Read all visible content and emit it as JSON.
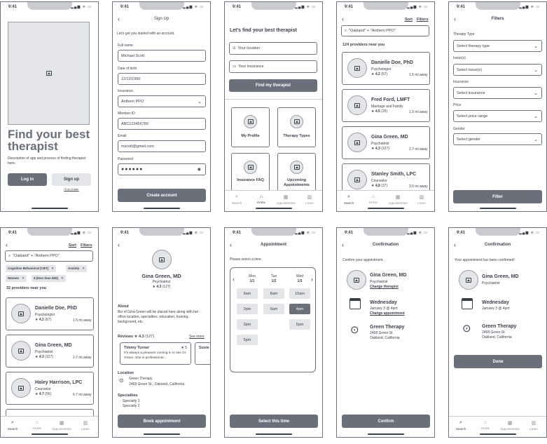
{
  "status": {
    "time": "9:41",
    "icons": "▂▄▆ ≋ ▭"
  },
  "screen1": {
    "title": "Find your best therapist",
    "desc": "Description of app and process of finding therapist here.",
    "login": "Log in",
    "signup": "Sign up",
    "later": "I'll do it later"
  },
  "screen2": {
    "title": "Sign Up",
    "intro": "Let's get you started with an account.",
    "fields": [
      {
        "label": "Full name",
        "value": "Michael Scott"
      },
      {
        "label": "Date of birth",
        "value": "12/12/1990"
      },
      {
        "label": "Insurance",
        "value": "Anthem PPO"
      },
      {
        "label": "Member ID",
        "value": "ABC123456789"
      },
      {
        "label": "Email",
        "value": "mscott@gmail.com"
      },
      {
        "label": "Password",
        "value": "●●●●●●"
      }
    ],
    "create": "Create account"
  },
  "screen3": {
    "title": "Let's find your best therapist",
    "location_ph": "Your location",
    "insurance_ph": "Your insurance",
    "find": "Find my therapist",
    "tiles": [
      "My Profile",
      "Therapy Types",
      "Insurance FAQ",
      "Upcoming Appointments"
    ]
  },
  "tabs": [
    "Search",
    "Home",
    "Appointments",
    "Learn"
  ],
  "tab_icons": {
    "search": "⌕",
    "home": "⌂",
    "appointments": "▦",
    "learn": "▥"
  },
  "screen4": {
    "sort": "Sort",
    "filters": "Filters",
    "query": "\"Oakland\" + \"Anthem PPO\"",
    "count": "124 providers near you",
    "cards": [
      {
        "name": "Danielle Doe, PhD",
        "role": "Psychologist",
        "rating": "4.2",
        "reviews": "(67)",
        "dist": "1.5 mi away"
      },
      {
        "name": "Fred Ford, LMFT",
        "role": "Marriage and Family",
        "rating": "4.5",
        "reviews": "(25)",
        "dist": "1.9 mi away"
      },
      {
        "name": "Gina Green, MD",
        "role": "Psychiatrist",
        "rating": "4.3",
        "reviews": "(127)",
        "dist": "2.7 mi away"
      },
      {
        "name": "Stanley Smith, LPC",
        "role": "Counselor",
        "rating": "4.8",
        "reviews": "(37)",
        "dist": "3.5 mi away"
      }
    ]
  },
  "screen5": {
    "title": "Filters",
    "groups": [
      {
        "label": "Therapy Type",
        "placeholder": "Select therapy type"
      },
      {
        "label": "Issue(s)",
        "placeholder": "Select issue(s)"
      },
      {
        "label": "Insurance",
        "placeholder": "Select insurance"
      },
      {
        "label": "Price",
        "placeholder": "Select price range"
      },
      {
        "label": "Gender",
        "placeholder": "Select gender"
      }
    ],
    "filter": "Filter"
  },
  "screen6": {
    "sort": "Sort",
    "filters": "Filters",
    "query": "\"Oakland\" + \"Anthem PPO\"",
    "chips": [
      "Cognitive Behavioral (CBT)",
      "Anxiety",
      "Women",
      "$ (less than $50)"
    ],
    "count": "32 providers near you",
    "cards": [
      {
        "name": "Danielle Doe, PhD",
        "role": "Psychologist",
        "rating": "4.2",
        "reviews": "(67)",
        "dist": "1.5 mi away"
      },
      {
        "name": "Gina Green, MD",
        "role": "Psychiatrist",
        "rating": "4.3",
        "reviews": "(127)",
        "dist": "2.7 mi away"
      },
      {
        "name": "Haley Harrison, LPC",
        "role": "Counselor",
        "rating": "4.7",
        "reviews": "(56)",
        "dist": "6.7 mi away"
      }
    ]
  },
  "screen7": {
    "name": "Gina Green, MD",
    "role": "Psychiatrist",
    "rating": "4.3",
    "reviews": "(127)",
    "about_h": "About",
    "about": "Bio of Gina Green will be placed here along with her office location, specialties, education, training, background, etc.",
    "reviews_h": "Reviews",
    "see_more": "See more",
    "review": {
      "author": "Timmy Turner",
      "stars": "5",
      "text": "It's always a pleasure coming in to see Dr. Green. She is professional..."
    },
    "review2_author": "Susie",
    "location_h": "Location",
    "location": "Green Therapy",
    "address": "2468 Green St., Oakland, California",
    "spec_h": "Specialties",
    "specs": [
      "· Specialty 1",
      "· Specialty 2"
    ],
    "book": "Book appointment"
  },
  "screen8": {
    "title": "Appointment",
    "prompt": "Please select a time.",
    "days": [
      {
        "d": "Mon",
        "date": "1/1"
      },
      {
        "d": "Tue",
        "date": "1/2"
      },
      {
        "d": "Wed",
        "date": "1/3"
      }
    ],
    "mon": [
      "9am",
      "2pm",
      "3pm",
      "5pm"
    ],
    "tue": [
      "8am",
      "9am"
    ],
    "wed": [
      "10am",
      "4pm",
      "5pm"
    ],
    "select": "Select this time"
  },
  "screen9": {
    "title": "Confirmation",
    "prompt": "Confirm your appointment.",
    "name": "Gina Green, MD",
    "role": "Psychiatrist",
    "change_t": "Change therapist",
    "day": "Wednesday",
    "when": "January 3 @ 4pm",
    "change_a": "Change appointment",
    "place": "Green Therapy",
    "street": "2468 Green St.",
    "city": "Oakland, California",
    "confirm": "Confirm"
  },
  "screen10": {
    "title": "Confirmation",
    "msg": "Your appointment has been confirmed!",
    "name": "Gina Green, MD",
    "role": "Psychiatrist",
    "day": "Wednesday",
    "when": "January 3 @ 4pm",
    "place": "Green Therapy",
    "street": "2468 Green St.",
    "city": "Oakland, California",
    "done": "Done"
  }
}
